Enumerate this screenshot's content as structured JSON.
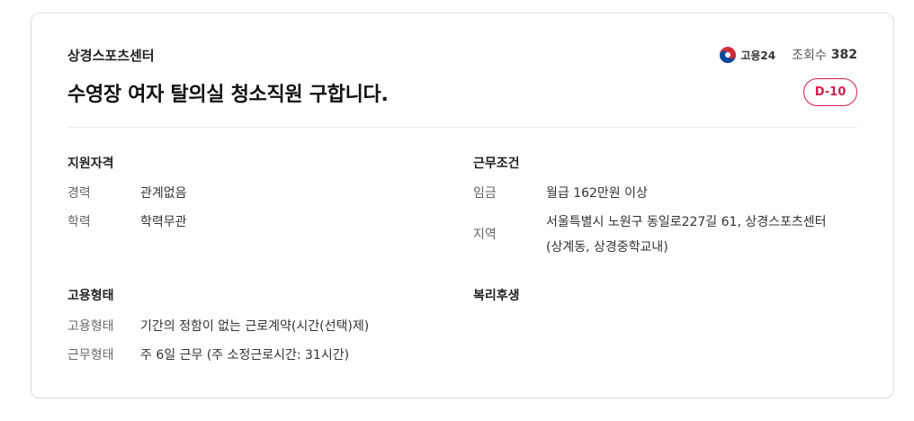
{
  "header": {
    "company": "상경스포츠센터",
    "title": "수영장 여자 탈의실 청소직원 구합니다.",
    "logo_text": "고용24",
    "views_label": "조회수",
    "views_count": "382",
    "dday": "D-10"
  },
  "qualification": {
    "title": "지원자격",
    "rows": [
      {
        "label": "경력",
        "value": "관계없음"
      },
      {
        "label": "학력",
        "value": "학력무관"
      }
    ]
  },
  "conditions": {
    "title": "근무조건",
    "rows": [
      {
        "label": "임금",
        "value": "월급 162만원 이상"
      },
      {
        "label": "지역",
        "value_line1": "서울특별시 노원구 동일로227길 61, 상경스포츠센터",
        "value_line2": "(상계동, 상경중학교내)"
      }
    ]
  },
  "employment": {
    "title": "고용형태",
    "rows": [
      {
        "label": "고용형태",
        "value": "기간의 정함이 없는 근로계약(시간(선택)제)"
      },
      {
        "label": "근무형태",
        "value": "주 6일 근무 (주 소정근로시간: 31시간)"
      }
    ]
  },
  "benefits": {
    "title": "복리후생"
  },
  "colors": {
    "accent": "#d41c4b",
    "border": "#dddddd"
  }
}
